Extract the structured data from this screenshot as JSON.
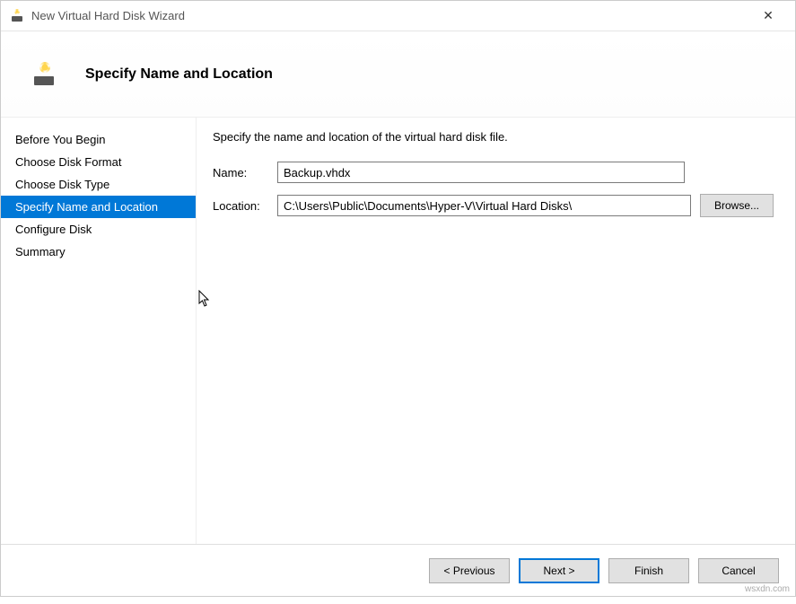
{
  "window": {
    "title": "New Virtual Hard Disk Wizard"
  },
  "header": {
    "title": "Specify Name and Location"
  },
  "sidebar": {
    "items": [
      {
        "label": "Before You Begin",
        "selected": false
      },
      {
        "label": "Choose Disk Format",
        "selected": false
      },
      {
        "label": "Choose Disk Type",
        "selected": false
      },
      {
        "label": "Specify Name and Location",
        "selected": true
      },
      {
        "label": "Configure Disk",
        "selected": false
      },
      {
        "label": "Summary",
        "selected": false
      }
    ]
  },
  "main": {
    "instruction": "Specify the name and location of the virtual hard disk file.",
    "name_label": "Name:",
    "name_value": "Backup.vhdx",
    "location_label": "Location:",
    "location_value": "C:\\Users\\Public\\Documents\\Hyper-V\\Virtual Hard Disks\\",
    "browse_label": "Browse..."
  },
  "footer": {
    "previous_label": "< Previous",
    "next_label": "Next >",
    "finish_label": "Finish",
    "cancel_label": "Cancel"
  },
  "watermark": "wsxdn.com"
}
